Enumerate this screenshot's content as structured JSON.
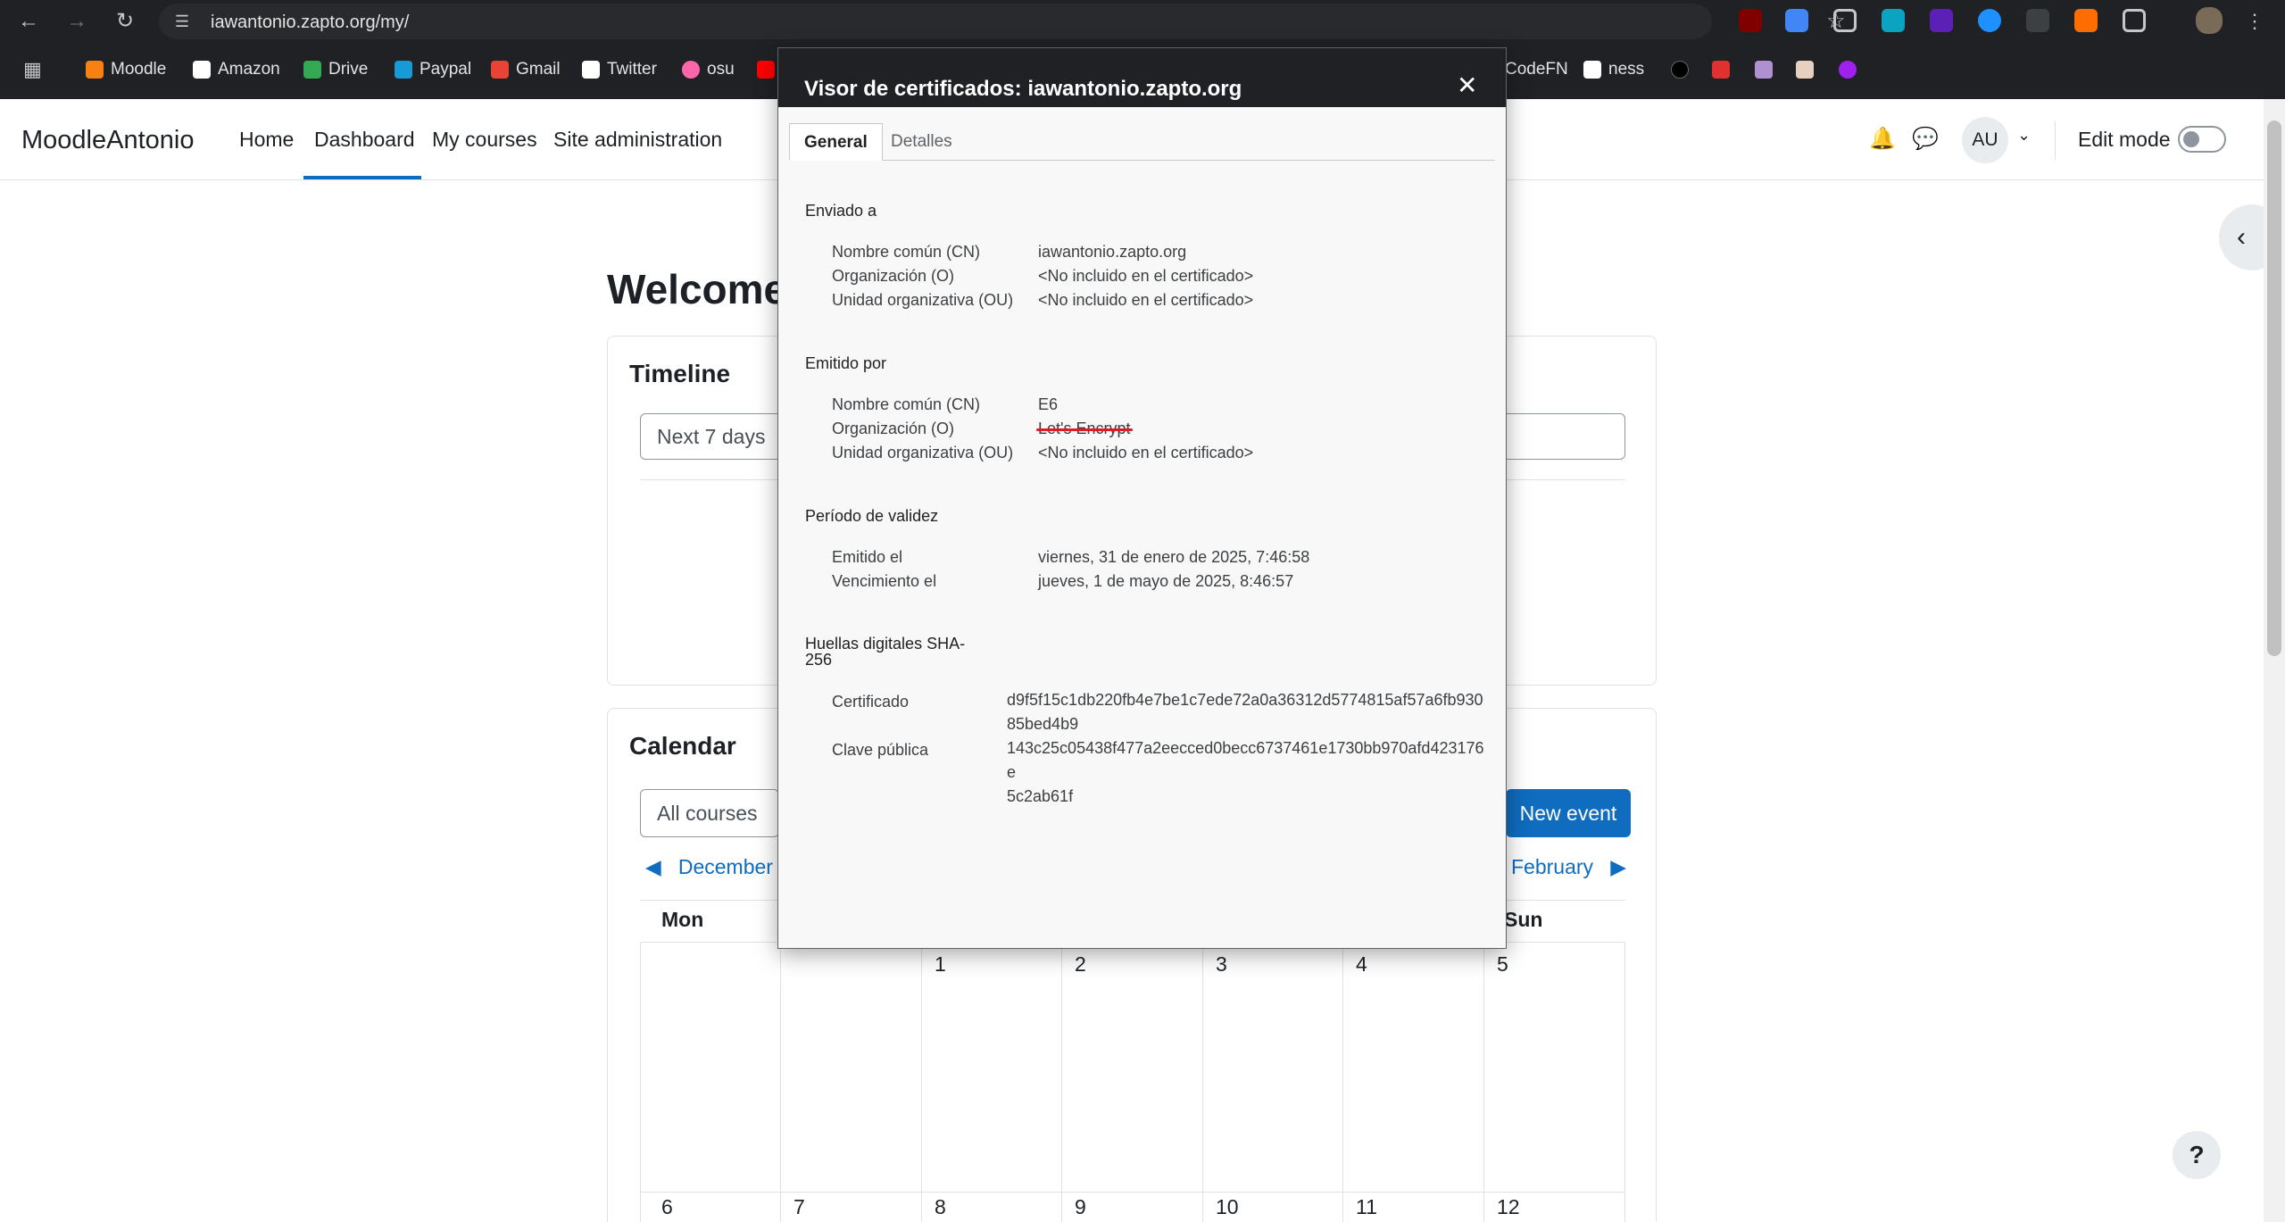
{
  "browser": {
    "url": "iawantonio.zapto.org/my/",
    "bookmarks": [
      {
        "label": "Moodle",
        "icon": "moodle-icon",
        "color": "#f98012"
      },
      {
        "label": "Amazon",
        "icon": "amazon-icon",
        "color": "#ffffff"
      },
      {
        "label": "Drive",
        "icon": "drive-icon",
        "color": "#34a853"
      },
      {
        "label": "Paypal",
        "icon": "paypal-icon",
        "color": "#179bd7"
      },
      {
        "label": "Gmail",
        "icon": "gmail-icon",
        "color": "#ea4335"
      },
      {
        "label": "Twitter",
        "icon": "x-icon",
        "color": "#ffffff"
      },
      {
        "label": "osu",
        "icon": "osu-icon",
        "color": "#ff66aa"
      }
    ],
    "bookmarks_right": [
      {
        "label": "CodeFN",
        "icon": "codefn-icon"
      },
      {
        "label": "ness",
        "icon": "wikipedia-icon"
      }
    ]
  },
  "moodle": {
    "brand": "MoodleAntonio",
    "nav": [
      "Home",
      "Dashboard",
      "My courses",
      "Site administration"
    ],
    "active_nav": "Dashboard",
    "avatar_initials": "AU",
    "edit_mode_label": "Edit mode",
    "welcome": "Welcome",
    "timeline": {
      "title": "Timeline",
      "range_select": "Next 7 days"
    },
    "calendar": {
      "title": "Calendar",
      "course_filter": "All courses",
      "new_event": "New event",
      "prev_month": "December",
      "next_month": "February",
      "days": [
        "Mon",
        "Sun"
      ],
      "week1": [
        "1",
        "2",
        "3",
        "4",
        "5"
      ],
      "week2": [
        "6",
        "7",
        "8",
        "9",
        "10",
        "11",
        "12"
      ]
    },
    "help": "?"
  },
  "certificate": {
    "title": "Visor de certificados: iawantonio.zapto.org",
    "tabs": [
      "General",
      "Detalles"
    ],
    "active_tab": "General",
    "issued_to": {
      "heading": "Enviado a",
      "fields": [
        {
          "label": "Nombre común (CN)",
          "value": "iawantonio.zapto.org"
        },
        {
          "label": "Organización (O)",
          "value": "<No incluido en el certificado>"
        },
        {
          "label": "Unidad organizativa (OU)",
          "value": "<No incluido en el certificado>"
        }
      ]
    },
    "issued_by": {
      "heading": "Emitido por",
      "fields": [
        {
          "label": "Nombre común (CN)",
          "value": "E6"
        },
        {
          "label": "Organización (O)",
          "value": "Let's Encrypt"
        },
        {
          "label": "Unidad organizativa (OU)",
          "value": "<No incluido en el certificado>"
        }
      ]
    },
    "validity": {
      "heading": "Período de validez",
      "fields": [
        {
          "label": "Emitido el",
          "value": "viernes, 31 de enero de 2025, 7:46:58"
        },
        {
          "label": "Vencimiento el",
          "value": "jueves, 1 de mayo de 2025, 8:46:57"
        }
      ]
    },
    "fingerprints": {
      "heading_line1": "Huellas digitales SHA-",
      "heading_line2": "256",
      "fields": [
        {
          "label": "Certificado",
          "value_line1": "d9f5f15c1db220fb4e7be1c7ede72a0a36312d5774815af57a6fb930",
          "value_line2": "85bed4b9"
        },
        {
          "label": "Clave pública",
          "value_line1": "143c25c05438f477a2eecced0becc6737461e1730bb970afd423176e",
          "value_line2": "5c2ab61f"
        }
      ]
    },
    "highlight_color": "#e01b24"
  }
}
